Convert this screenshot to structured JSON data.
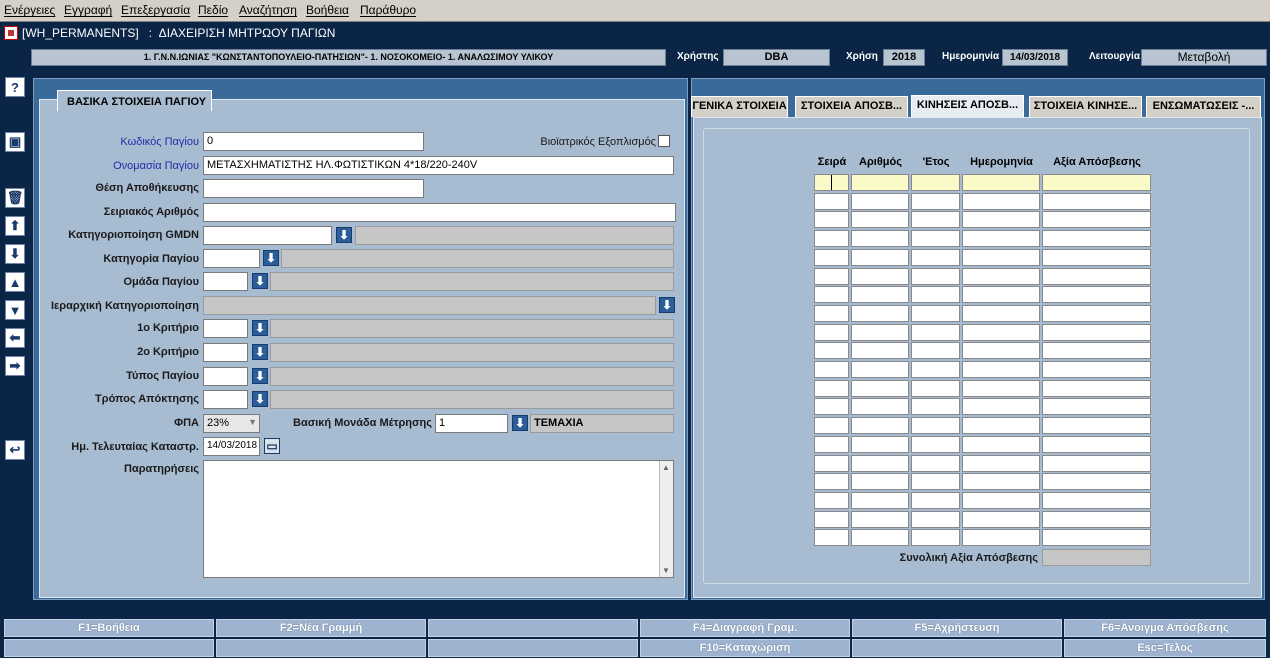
{
  "menu": [
    "Ενέργειες",
    "Εγγραφή",
    "Επεξεργασία",
    "Πεδίο",
    "Αναζήτηση",
    "Βοήθεια",
    "Παράθυρο"
  ],
  "window": {
    "title": "[WH_PERMANENTS]   :  ΔΙΑΧΕΙΡΙΣΗ ΜΗΤΡΩΟΥ ΠΑΓΙΩΝ"
  },
  "info": {
    "org": "1. Γ.Ν.Ν.ΙΩΝΙΑΣ \"ΚΩΝΣΤΑΝΤΟΠΟΥΛΕΙΟ-ΠΑΤΗΣΙΩΝ\"- 1. ΝΟΣΟΚΟΜΕΙΟ- 1. ΑΝΑΛΩΣΙΜΟΥ ΥΛΙΚΟΥ",
    "user_label": "Χρήστης",
    "user": "DBA",
    "year_label": "Χρήση",
    "year": "2018",
    "date_label": "Ημερομηνία",
    "date": "14/03/2018",
    "mode_label": "Λειτουργία",
    "mode": "Μεταβολή"
  },
  "toolbar_icons": [
    "help-icon",
    "save-icon",
    "delete-icon",
    "up-icon",
    "down-icon",
    "first-icon",
    "last-icon",
    "prev-icon",
    "next-icon",
    "undo-icon"
  ],
  "form": {
    "group_title": "ΒΑΣΙΚΑ ΣΤΟΙΧΕΙΑ ΠΑΓΙΟΥ",
    "code_label": "Κωδικός Παγίου",
    "code": "0",
    "bio_label": "Βιοϊατρικός Εξοπλισμός",
    "name_label": "Ονομασία Παγίου",
    "name": "ΜΕΤΑΣΧΗΜΑΤΙΣΤΗΣ ΗΛ.ΦΩΤΙΣΤΙΚΩΝ 4*18/220-240V",
    "storage_label": "Θέση Αποθήκευσης",
    "serial_label": "Σειριακός Αριθμός",
    "gmdn_label": "Κατηγοριοποίηση GMDN",
    "category_label": "Κατηγορία Παγίου",
    "group_label": "Ομάδα Παγίου",
    "hier_label": "Ιεραρχική Κατηγοριοποίηση",
    "crit1_label": "1ο Κριτήριο",
    "crit2_label": "2ο Κριτήριο",
    "type_label": "Τύπος Παγίου",
    "acq_label": "Τρόπος Απόκτησης",
    "vat_label": "ΦΠΑ",
    "vat": "23%",
    "unit_label": "Βασική Μονάδα Μέτρησης",
    "unit_code": "1",
    "unit_name": "ΤΕΜΑΧΙΑ",
    "inv_label": "Ημ. Τελευταίας Καταστρ.",
    "inv_date": "14/03/2018",
    "notes_label": "Παρατηρήσεις"
  },
  "tabs": [
    "ΓΕΝΙΚΑ ΣΤΟΙΧΕΙΑ",
    "ΣΤΟΙΧΕΙΑ ΑΠΟΣΒ...",
    "ΚΙΝΗΣΕΙΣ ΑΠΟΣΒ...",
    "ΣΤΟΙΧΕΙΑ ΚΙΝΗΣΕ...",
    "ΕΝΣΩΜΑΤΩΣΕΙΣ -..."
  ],
  "grid": {
    "headers": [
      "Σειρά",
      "Αριθμός",
      "'Ετος",
      "Ημερομηνία",
      "Αξία Απόσβεσης"
    ],
    "rows": 20,
    "total_label": "Συνολική Αξία Απόσβεσης"
  },
  "fkeys_row1": [
    "F1=Βοήθεια",
    "F2=Νέα Γραμμή",
    "",
    "F4=Διαγραφή Γραμ.",
    "F5=Αχρήστευση",
    "F6=Ανοιγμα Απόσβεσης"
  ],
  "fkeys_row2": [
    "",
    "",
    "",
    "F10=Καταχώριση",
    "",
    "Esc=Τέλος"
  ],
  "colors": {
    "background": "#0a2546",
    "panel": "#a7bbd1",
    "selected_row": "#fafac8"
  }
}
